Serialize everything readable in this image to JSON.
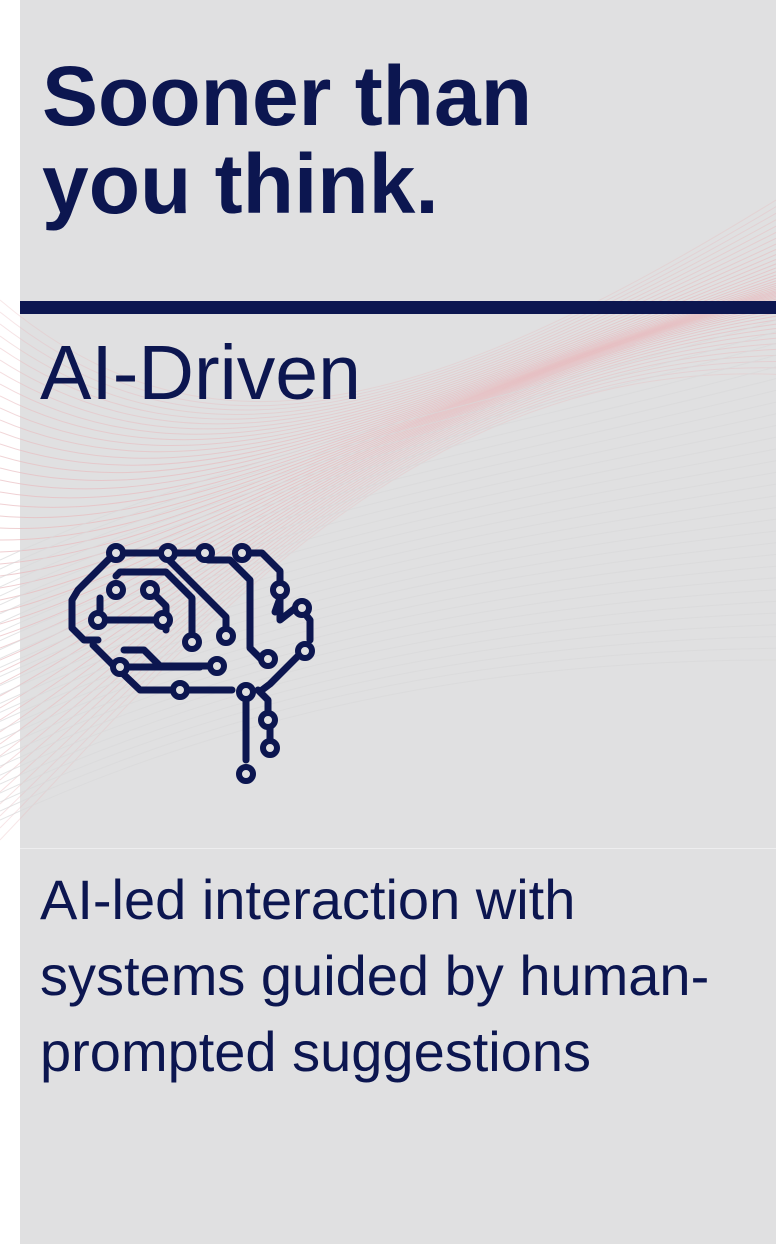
{
  "headline": {
    "line1": "Sooner than",
    "line2": "you think."
  },
  "subhead": "AI-Driven",
  "description": "AI-led interaction with systems guided by human-prompted suggestions",
  "icon": "circuit-brain-icon",
  "colors": {
    "navy": "#0c1650",
    "panel": "#e0e0e1",
    "wave": "#e8b9bd"
  }
}
